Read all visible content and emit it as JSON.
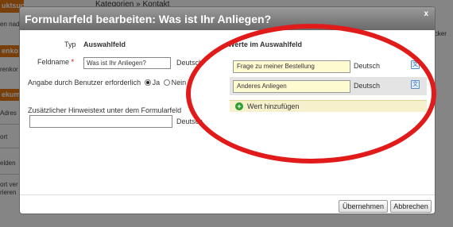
{
  "background": {
    "top_line": "Kategorien » Kontakt",
    "left_items": [
      {
        "text": "uktsuche",
        "style": "orange"
      },
      {
        "text": "en nad",
        "style": "text"
      },
      {
        "text": "enko",
        "style": "orange"
      },
      {
        "text": "renkor",
        "style": "text"
      },
      {
        "text": "ekum",
        "style": "orange"
      },
      {
        "text": "Adres",
        "style": "text"
      },
      {
        "text": "ort",
        "style": "text"
      },
      {
        "text": "elden",
        "style": "text"
      },
      {
        "text": "ort ver",
        "style": "text"
      },
      {
        "text": "rieren",
        "style": "text"
      }
    ],
    "right_text": "icker"
  },
  "dialog": {
    "title": "Formularfeld bearbeiten: Was ist Ihr Anliegen?",
    "close_label": "x",
    "typ_label": "Typ",
    "typ_value": "Auswahlfeld",
    "feldname_label": "Feldname",
    "required_mark": "*",
    "feldname_value": "Was ist Ihr Anliegen?",
    "feldname_lang": "Deutsch",
    "required_label": "Angabe durch Benutzer erforderlich",
    "option_yes": "Ja",
    "option_no": "Nein",
    "hint_label": "Zusätzlicher Hinweistext unter dem Formularfeld",
    "hint_value": "",
    "hint_lang": "Deutsch",
    "values_title": "Werte im Auswahlfeld",
    "values": [
      {
        "value": "Frage zu meiner Bestellung",
        "lang": "Deutsch"
      },
      {
        "value": "Anderes Anliegen",
        "lang": "Deutsch"
      }
    ],
    "add_value_label": "Wert hinzufügen",
    "apply_button": "Übernehmen",
    "cancel_button": "Abbrechen"
  },
  "colors": {
    "annotation": "#e11a1a",
    "sidebar_orange": "#e87a16",
    "value_input_bg": "#fffbd0",
    "add_icon": "#2e9b2e"
  }
}
